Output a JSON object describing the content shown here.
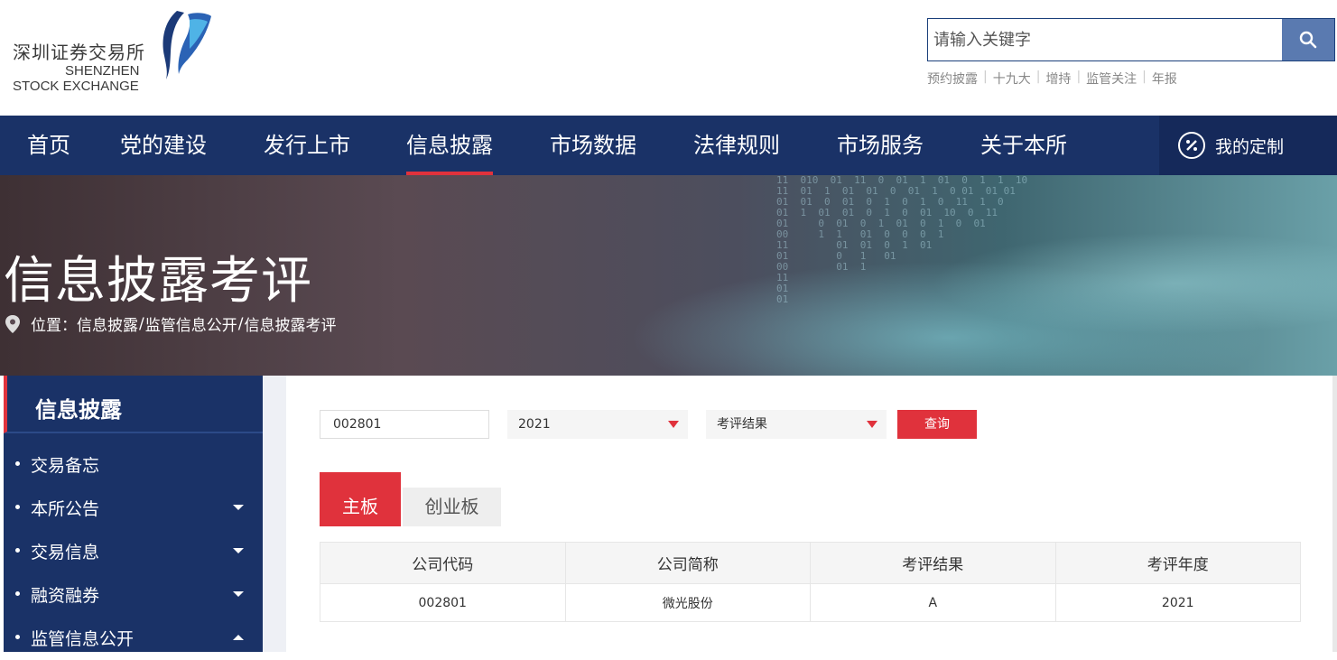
{
  "header": {
    "logo_cn": "深圳证券交易所",
    "logo_en_line1": "SHENZHEN",
    "logo_en_line2": "STOCK EXCHANGE",
    "search_placeholder": "请输入关键字",
    "hot_links": [
      "预约披露",
      "十九大",
      "增持",
      "监管关注",
      "年报"
    ]
  },
  "nav": {
    "items": [
      "首页",
      "党的建设",
      "发行上市",
      "信息披露",
      "市场数据",
      "法律规则",
      "市场服务",
      "关于本所"
    ],
    "active": "信息披露",
    "custom_label": "我的定制"
  },
  "banner": {
    "title": "信息披露考评",
    "breadcrumb_prefix": "位置：",
    "breadcrumb": [
      "信息披露",
      "监管信息公开",
      "信息披露考评"
    ]
  },
  "sidebar": {
    "header": "信息披露",
    "items": [
      {
        "label": "交易备忘",
        "caret": "none"
      },
      {
        "label": "本所公告",
        "caret": "down"
      },
      {
        "label": "交易信息",
        "caret": "down"
      },
      {
        "label": "融资融券",
        "caret": "down"
      },
      {
        "label": "监管信息公开",
        "caret": "up"
      }
    ]
  },
  "filters": {
    "code_value": "002801",
    "year_value": "2021",
    "result_value": "考评结果",
    "query_label": "查询"
  },
  "tabs": [
    {
      "label": "主板",
      "active": true
    },
    {
      "label": "创业板",
      "active": false
    }
  ],
  "table": {
    "columns": [
      "公司代码",
      "公司简称",
      "考评结果",
      "考评年度"
    ],
    "rows": [
      [
        "002801",
        "微光股份",
        "A",
        "2021"
      ]
    ]
  },
  "colors": {
    "nav_bg": "#1a3267",
    "accent_red": "#e0323c",
    "search_button": "#5a7ab0"
  }
}
